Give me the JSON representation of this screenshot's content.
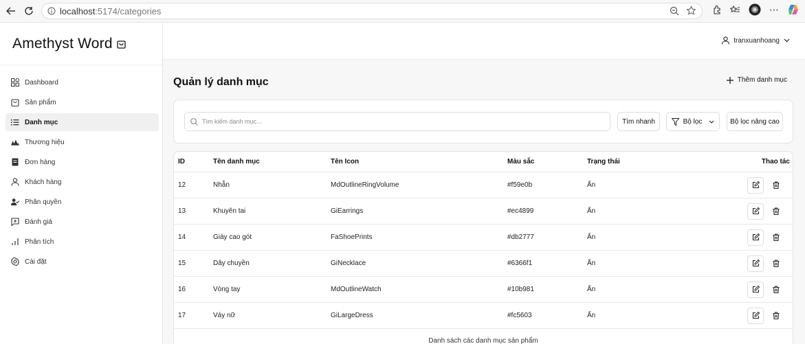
{
  "browser": {
    "url_host": "localhost",
    "url_path": ":5174/categories"
  },
  "brand": {
    "title": "Amethyst Word"
  },
  "sidebar": {
    "items": [
      {
        "label": "Dashboard",
        "icon": "dashboard-icon"
      },
      {
        "label": "Sản phẩm",
        "icon": "bag-icon"
      },
      {
        "label": "Danh mục",
        "icon": "list-icon",
        "active": true
      },
      {
        "label": "Thương hiệu",
        "icon": "brand-icon"
      },
      {
        "label": "Đơn hàng",
        "icon": "order-icon"
      },
      {
        "label": "Khách hàng",
        "icon": "user-icon"
      },
      {
        "label": "Phân quyền",
        "icon": "user-check-icon"
      },
      {
        "label": "Đánh giá",
        "icon": "review-icon"
      },
      {
        "label": "Phân tích",
        "icon": "bar-chart-icon"
      },
      {
        "label": "Cài đặt",
        "icon": "gear-icon"
      }
    ]
  },
  "header": {
    "username": "tranxuanhoang"
  },
  "main": {
    "title": "Quản lý danh mục",
    "add_label": "Thêm danh mục",
    "search_placeholder": "Tìm kiếm danh mục...",
    "quick_search_label": "Tìm nhanh",
    "filter_label": "Bộ lọc",
    "advanced_filter_label": "Bộ lọc nâng cao"
  },
  "table": {
    "headers": {
      "id": "ID",
      "name": "Tên danh mục",
      "icon": "Tên Icon",
      "color": "Màu sắc",
      "status": "Trạng thái",
      "actions": "Thao tác"
    },
    "rows": [
      {
        "id": "12",
        "name": "Nhẫn",
        "icon": "MdOutlineRingVolume",
        "color": "#f59e0b",
        "status": "Ẩn"
      },
      {
        "id": "13",
        "name": "Khuyên tai",
        "icon": "GiEarrings",
        "color": "#ec4899",
        "status": "Ẩn"
      },
      {
        "id": "14",
        "name": "Giày cao gót",
        "icon": "FaShoePrints",
        "color": "#db2777",
        "status": "Ẩn"
      },
      {
        "id": "15",
        "name": "Dây chuyền",
        "icon": "GiNecklace",
        "color": "#6366f1",
        "status": "Ẩn"
      },
      {
        "id": "16",
        "name": "Vòng tay",
        "icon": "MdOutlineWatch",
        "color": "#10b981",
        "status": "Ẩn"
      },
      {
        "id": "17",
        "name": "Váy nữ",
        "icon": "GiLargeDress",
        "color": "#fc5603",
        "status": "Ẩn"
      }
    ],
    "caption": "Danh sách các danh mục sản phẩm"
  }
}
